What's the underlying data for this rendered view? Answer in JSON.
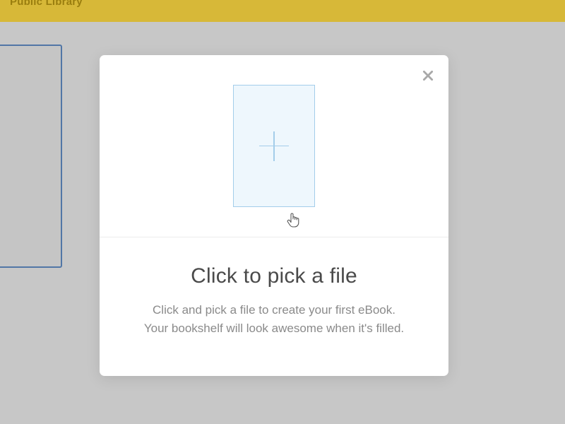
{
  "topbar": {
    "title": "Public Library"
  },
  "modal": {
    "title": "Click to pick a file",
    "desc_line1": "Click and pick a file to create your first eBook.",
    "desc_line2": "Your bookshelf will look awesome when it's filled."
  }
}
